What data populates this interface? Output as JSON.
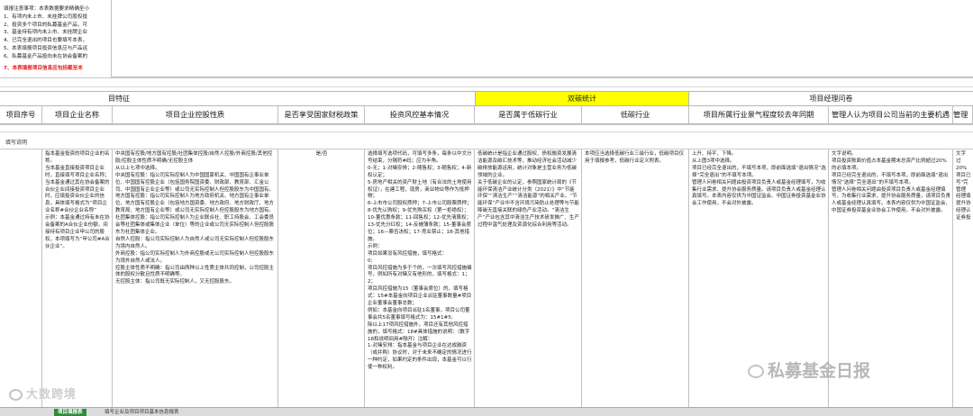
{
  "notes": {
    "lines": [
      "填报注意事项：本表数据要求精确至小",
      "1、有项内未上市、未挂牌公司股权投",
      "2、投资多个项目的私募基金产品，可",
      "3、基金持有项内未上市、未挂牌企业",
      "4、已完全退出的项目也要填写本表，",
      "5、本表填报项目投资信息应与产品运",
      "6、私募基金产品投向未在协会备案的"
    ],
    "red_line": "7、本表填报项目信息应包括截至本"
  },
  "bands": {
    "left": "目特征",
    "middle": "双碳统计",
    "right": "项目经理问卷"
  },
  "columns": [
    "项目序号",
    "项目企业名称",
    "项目企业控股性质",
    "是否享受国家财税政策",
    "投资风控基本情况",
    "是否属于低碳行业",
    "低碳行业",
    "项目所属行业景气程度较去年同期",
    "管理人认为项目公司当前的主要机遇",
    "管理"
  ],
  "fill_label": "填写说明",
  "cells": {
    "name": "指本基金投资的项目企业的名称。\n当本基金直接投资项目企业时，直接填写项目企业名称；当本基金通过其在协会备案的合伙企业间接投资项目企业时，应填投资合伙企业的信息，具体填写格式为“项目企业名称#合伙企业名称”\n示例：本基金通过持有未在协会备案的A合伙企业份额，间接持有项目企业甲公司的股权，本项填写为“甲公司#A合伙企业”。",
    "control": "中央国有控股/地方国有控股/社团集体控股/自然人控股/外商控股/其他控股/控股主体性质不明确/无控股主体\n从以上七项中选择。\n中央国有控股：指公司实际控制人为中国国家机关、中国国有企事业单位、中国国有控股企业（包括国务院国资委、财政部、教育部、汇金公司、中国国有企业企业等）或公司无实际控制人但控股股东为中国国有。\n地方国有控股：指公司实际控制人为地方政府机关、地方国有企事业单位、地方国有控股企业（包括地方国资委、地方政府、地方财政厅、地方教育局、地方国有企业等）或公司无实际控制人但控股股东为地方国有。\n社团集体控股：指公司实际控制人为企业联合社、职工持股会、工会委员会等社团集体或集体企业（单位）等的企业或公司无实际控制人但控股股东为社团集体企业。\n自然人控股：指公司实际控制人为自然人或公司无实际控制人但控股股东为境内自然人。\n外商控股：指公司实际控制人为外商控股或无公司实际控制人但控股股东为境外自然人或法人。\n控股主体性质不明确：指公司由两种以上性质主体共同控制，公司控股主体的股权分散且性质不明确等。\n无控股主体：指公司既无实际控制人，又无控股股东。",
    "policy": "是/否",
    "risk": "选择填写选项代码，可填写多条，每条以中文分号结束，分隔符#码；应为半角。\n0-无；1-对赌安排；2-随售权；3-随售权；4-新权认定；\n5-房地产相关的资产财土地（有合法的土地使用权证），在建工程，现房，商业物业等作为抵押物；\n6-上市市公司股权质押；7-上市公司股票质押；8-优先认购权；9-优先购买权（第一拒绝权）；10-董优惠条款；11-回售权；12-优先清算权；13-优先分红权；14-反摊薄条款；15-董事会席位；16—票否决权；17-竞业禁止；18-其他措施。\n示例：\n项目如果没有风控措施，填写格式：\n0;\n项目风控措施为多于个的，一次填写风控措施编号，例如所有对赌又有他形的，填写格式：1；2；\n项目风控措施为15（董事会席位）的，填写格式：15#本基金向项目企业派驻董事数量#项目企业董事会董事总数；\n例如：本基金向项目派驻1名董事，项目公司董事会共5名董事填写格式为：15#1#5;\n除以上17项风控措施外，项目还有其他风控措施的，填写格式：18#具体措施的说明：（数字18和说明间用#隔开）注解：\n1-对赌安排：指本基金与项目企业在达成融资（或并购）协议时，对于未来不确定的情况进行一种约定，如果约定的条件出现，本基金可以行使一种权利。",
    "lowcarbon": "低碳统计是指企业通过股权、债权融资发展清洁能源及碳汇技术等，推动经济社会活动减少碳排放能源运用，统计对象是主营业务为低碳领域的企业。\n关于低碳企业的认定，参照国家统计局的《节能环保清洁产业统计分类（2021）》中“节能环保”“清洁生产”“清洁能源”的相关产业。“节能环保”产业中不含环境污染防止处理等与节能降碳无直接关联的绿色产业活动。“清洁生产”产业包含其中清洁生产技术研发推广、生产过程中温气处理及资源化综合利用等活动。",
    "lowcarbon_industry": "本项应当选择低碳行业三级行业，低碳项目仅用于填报参考，低碳行业定义附表。",
    "climate": "上升、持平、下降。\n从上图3项中选择。\n项目已经完全退出的，不填写本项，即前面选填“退出情况”选择“完全退出”的不填写本项。\n管理人问卷相关问题由投资项目负责人或基金经理填写，为收集行业需求、提升协会服务质量。请项目负责人或基金经理认真填写。本表内容仅供为中国证监会、中国证券投资基金业协会工作使用，不会对外披露。",
    "opportunity": "文字说明。\n项目投资账面价值占本基金期末总资产比例超过20%的必填本项。\n项目已经完全退出的，不填写本项，即前面选填“退出情况”选择“完全退出”的不填写本项。\n管理人问卷相关问题由投资项目负责人或基金经理填写，为收集行业需求，提升协会服务质量，请项目负责人或基金经理认真填写。本表内容仅供为中国证监会、中国证券投资基金业协会工作使用，不会对外披露。",
    "last": "文字\n过20%\n项目已\n写\"完\n管理\n经理填\n提升协\n经理认\n证券投"
  },
  "tabs": [
    "项目填报表",
    "填写企业及项目项目基本信息报表"
  ],
  "watermarks": {
    "left": "大数跨境",
    "right": "私募基金日报"
  },
  "colors": {
    "yellow_band": "#ffff00",
    "active_tab": "#2e8b3e",
    "note_red": "#e01a1a"
  }
}
